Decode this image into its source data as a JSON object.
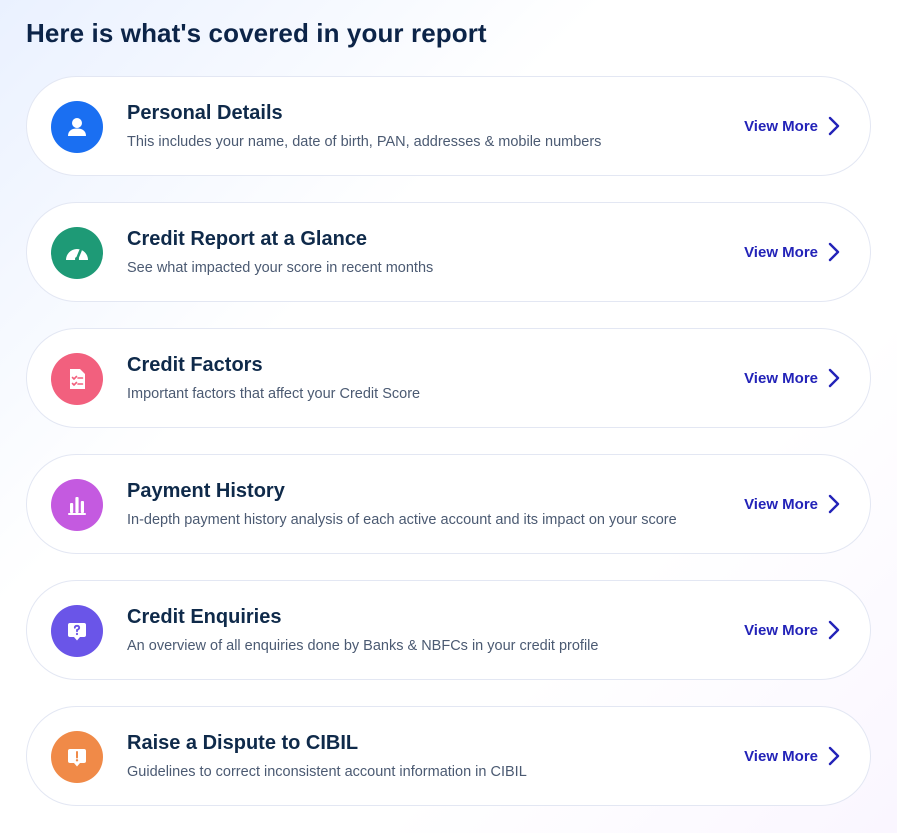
{
  "page": {
    "title": "Here is what's covered in your report"
  },
  "items": [
    {
      "title": "Personal Details",
      "description": "This includes your name, date of birth, PAN, addresses & mobile numbers",
      "cta": "View More",
      "icon": "user-icon",
      "color": "#1a6ff2"
    },
    {
      "title": "Credit Report at a Glance",
      "description": "See what impacted your score in recent months",
      "cta": "View More",
      "icon": "gauge-icon",
      "color": "#1e9a76"
    },
    {
      "title": "Credit Factors",
      "description": "Important factors that affect your Credit Score",
      "cta": "View More",
      "icon": "checklist-document-icon",
      "color": "#f2607e"
    },
    {
      "title": "Payment History",
      "description": "In-depth payment history analysis of each active account and its impact on your score",
      "cta": "View More",
      "icon": "bar-chart-icon",
      "color": "#c45ae0"
    },
    {
      "title": "Credit Enquiries",
      "description": "An overview of all enquiries done by Banks & NBFCs in your credit profile",
      "cta": "View More",
      "icon": "question-bubble-icon",
      "color": "#6a55e8"
    },
    {
      "title": "Raise a Dispute to CIBIL",
      "description": "Guidelines to correct inconsistent account information in CIBIL",
      "cta": "View More",
      "icon": "alert-bubble-icon",
      "color": "#f08a48"
    }
  ],
  "colors": {
    "link": "#2323b8",
    "heading": "#0c2448"
  }
}
